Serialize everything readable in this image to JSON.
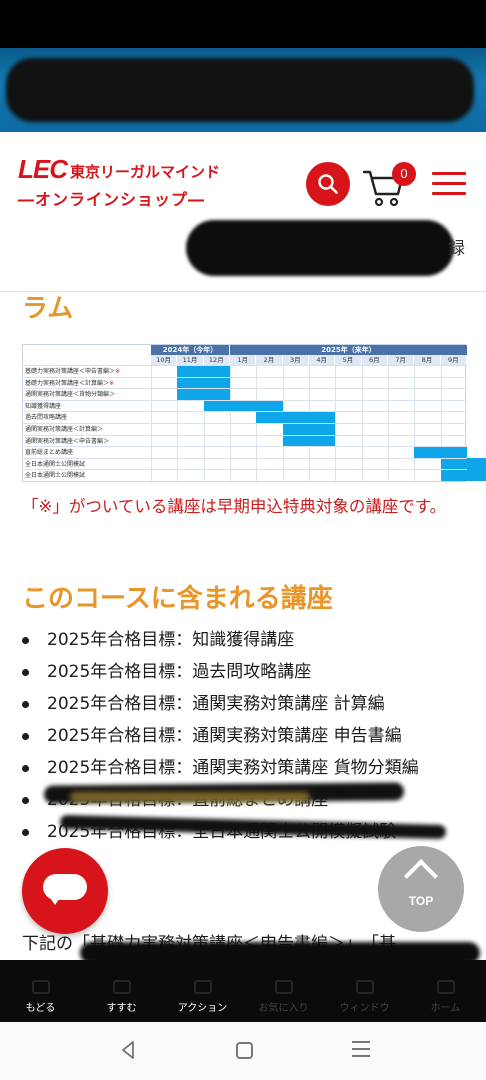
{
  "header": {
    "logo_mark": "LEC",
    "logo_brand": "東京リーガルマインド",
    "logo_sub": "―オンラインショップ―",
    "cart_count": "0",
    "redacted_tail": "録"
  },
  "main": {
    "section_tail": "ラム",
    "schedule": {
      "year_headers": [
        "2024年（今年）",
        "2025年（来年）"
      ],
      "months": [
        "10月",
        "11月",
        "12月",
        "1月",
        "2月",
        "3月",
        "4月",
        "5月",
        "6月",
        "7月",
        "8月",
        "9月"
      ],
      "rows": [
        {
          "label": "基礎力実務対策講座＜申告書編＞",
          "mark": "※",
          "start": 1,
          "end": 2
        },
        {
          "label": "基礎力実務対策講座＜計算編＞",
          "mark": "※",
          "start": 1,
          "end": 2
        },
        {
          "label": "通関実務対策講座＜貨物分類編＞",
          "mark": "",
          "start": 1,
          "end": 2
        },
        {
          "label": "知識獲得講座",
          "mark": "",
          "start": 2,
          "end": 4
        },
        {
          "label": "過去問攻略講座",
          "mark": "",
          "start": 4,
          "end": 6
        },
        {
          "label": "通関実務対策講座＜計算編＞",
          "mark": "",
          "start": 5,
          "end": 6
        },
        {
          "label": "通関実務対策講座＜申告書編＞",
          "mark": "",
          "start": 5,
          "end": 6
        },
        {
          "label": "直前総まとめ講座",
          "mark": "",
          "start": 10,
          "end": 11
        },
        {
          "label": "全日本通関士公開模試",
          "mark": "",
          "start": 11,
          "end": 12
        },
        {
          "label": "全日本通関士公開模試",
          "mark": "",
          "start": 11,
          "end": 12
        }
      ]
    },
    "note": "「※」がついている講座は早期申込特典対象の講座です。",
    "course_title": "このコースに含まれる講座",
    "courses": [
      "2025年合格目標：知識獲得講座",
      "2025年合格目標：過去問攻略講座",
      "2025年合格目標：通関実務対策講座 計算編",
      "2025年合格目標：通関実務対策講座 申告書編",
      "2025年合格目標：通関実務対策講座 貨物分類編",
      "2025年合格目標：直前総まとめ講座",
      "2025年合格目標：全日本通関士公開模擬試験"
    ],
    "top_label": "TOP",
    "bottom_text": "下記の「基礎力実務対策講座＜申告書編＞」、「基"
  },
  "toolbar": {
    "items": [
      "もどる",
      "すすむ",
      "アクション",
      "お気に入り",
      "ウィンドウ",
      "ホーム"
    ]
  },
  "colors": {
    "brand_red": "#d7141a",
    "accent_orange": "#e8952a",
    "bar_blue": "#0ea6e8"
  }
}
